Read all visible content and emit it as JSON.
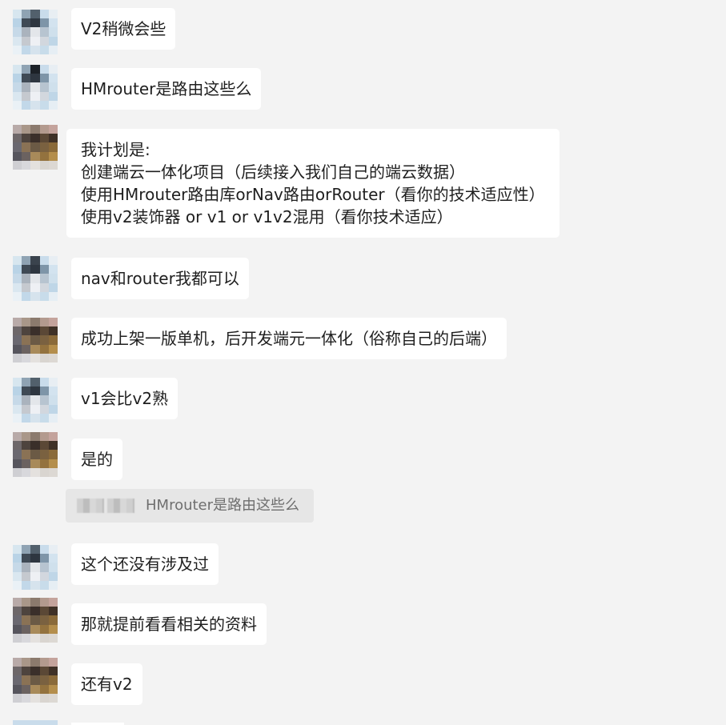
{
  "chat": {
    "messages": [
      {
        "sender": "a",
        "lines": [
          "V2稍微会些"
        ]
      },
      {
        "sender": "a",
        "lines": [
          "HMrouter是路由这些么"
        ]
      },
      {
        "sender": "b",
        "lines": [
          "我计划是:",
          "创建端云一体化项目（后续接入我们自己的端云数据）",
          "使用HMrouter路由库orNav路由orRouter（看你的技术适应性）",
          "使用v2装饰器 or v1 or v1v2混用（看你技术适应）"
        ]
      },
      {
        "sender": "a",
        "lines": [
          "nav和router我都可以"
        ]
      },
      {
        "sender": "b",
        "lines": [
          "成功上架一版单机，后开发端元一体化（俗称自己的后端）"
        ]
      },
      {
        "sender": "a",
        "lines": [
          "v1会比v2熟"
        ]
      },
      {
        "sender": "b",
        "lines": [
          "是的"
        ]
      },
      {
        "sender": "a",
        "lines": [
          "这个还没有涉及过"
        ]
      },
      {
        "sender": "b",
        "lines": [
          "那就提前看看相关的资料"
        ]
      },
      {
        "sender": "b",
        "lines": [
          "还有v2"
        ]
      }
    ],
    "quote": {
      "text": "HMrouter是路由这些么"
    }
  },
  "colors": {
    "background": "#f3f3f3",
    "bubble": "#ffffff",
    "quote_bg": "#e6e6e6"
  },
  "icons": {
    "avatar": "pixelated-avatar"
  }
}
